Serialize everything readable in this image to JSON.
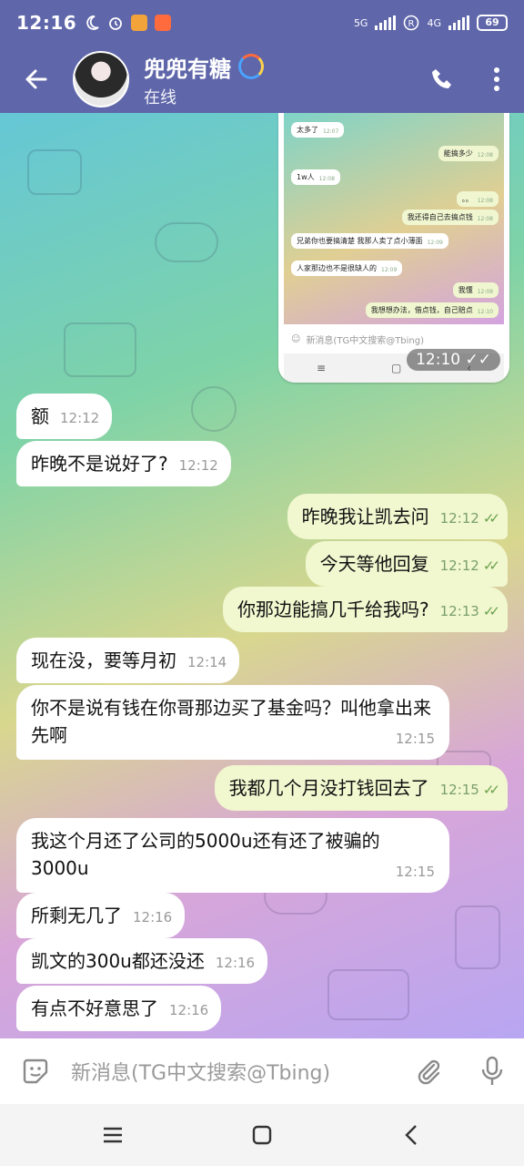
{
  "status_bar": {
    "time": "12:16",
    "network": "5G",
    "network2": "4G",
    "battery": "69"
  },
  "header": {
    "title": "兜兜有糖",
    "status": "在线"
  },
  "embedded_screenshot": {
    "messages": [
      {
        "text": "太多了",
        "time": "12:07",
        "dir": "in"
      },
      {
        "text": "能搞多少",
        "time": "12:08",
        "dir": "out"
      },
      {
        "text": "1w人",
        "time": "12:08",
        "dir": "in"
      },
      {
        "text": "。。",
        "time": "12:08",
        "dir": "out"
      },
      {
        "text": "我还得自己去搞点钱",
        "time": "12:08",
        "dir": "out"
      },
      {
        "text": "兄弟你也要搞清楚 我那人卖了点小薄面",
        "time": "12:09",
        "dir": "in"
      },
      {
        "text": "人家那边也不是很缺人的",
        "time": "12:09",
        "dir": "in"
      },
      {
        "text": "我懂",
        "time": "12:09",
        "dir": "out"
      },
      {
        "text": "我想想办法，借点钱，自己赔点",
        "time": "12:10",
        "dir": "out"
      }
    ],
    "input_placeholder": "新消息(TG中文搜索@Tbing)",
    "timestamp": "12:10"
  },
  "messages": [
    {
      "text": "额",
      "time": "12:12",
      "dir": "in"
    },
    {
      "text": "昨晚不是说好了?",
      "time": "12:12",
      "dir": "in"
    },
    {
      "text": "昨晚我让凯去问",
      "time": "12:12",
      "dir": "out"
    },
    {
      "text": "今天等他回复",
      "time": "12:12",
      "dir": "out"
    },
    {
      "text": "你那边能搞几千给我吗?",
      "time": "12:13",
      "dir": "out"
    },
    {
      "text": "现在没，要等月初",
      "time": "12:14",
      "dir": "in"
    },
    {
      "text": "你不是说有钱在你哥那边买了基金吗？叫他拿出来先啊",
      "time": "12:15",
      "dir": "in"
    },
    {
      "text": "我都几个月没打钱回去了",
      "time": "12:15",
      "dir": "out"
    },
    {
      "text": "我这个月还了公司的5000u还有还了被骗的3000u",
      "time": "12:15",
      "dir": "in"
    },
    {
      "text": "所剩无几了",
      "time": "12:16",
      "dir": "in"
    },
    {
      "text": "凯文的300u都还没还",
      "time": "12:16",
      "dir": "in"
    },
    {
      "text": "有点不好意思了",
      "time": "12:16",
      "dir": "in"
    }
  ],
  "input": {
    "placeholder": "新消息(TG中文搜索@Tbing)"
  },
  "colors": {
    "header": "#5f66aa",
    "bubble_in": "#ffffff",
    "bubble_out": "#f1f7cf",
    "check": "#6aa04a"
  }
}
